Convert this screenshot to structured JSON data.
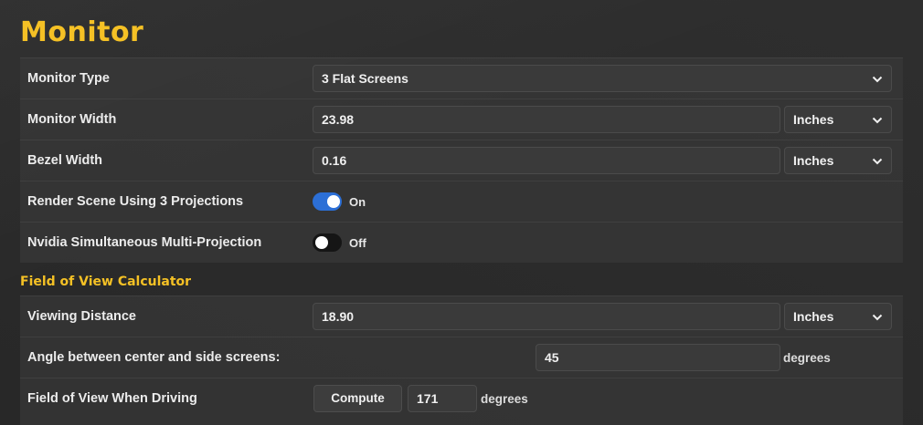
{
  "page": {
    "title": "Monitor"
  },
  "rows": {
    "monitor_type": {
      "label": "Monitor Type",
      "value": "3 Flat Screens"
    },
    "monitor_width": {
      "label": "Monitor Width",
      "value": "23.98",
      "unit": "Inches"
    },
    "bezel_width": {
      "label": "Bezel Width",
      "value": "0.16",
      "unit": "Inches"
    },
    "render_projections": {
      "label": "Render Scene Using 3 Projections",
      "state": "On"
    },
    "nvidia_smp": {
      "label": "Nvidia Simultaneous Multi-Projection",
      "state": "Off"
    }
  },
  "fov": {
    "heading": "Field of View Calculator",
    "viewing_distance": {
      "label": "Viewing Distance",
      "value": "18.90",
      "unit": "Inches"
    },
    "angle": {
      "label": "Angle between center and side screens:",
      "value": "45",
      "unit": "degrees"
    },
    "fov_driving": {
      "label": "Field of View When Driving",
      "button": "Compute",
      "value": "171",
      "unit": "degrees"
    }
  },
  "colors": {
    "accent": "#f5c125",
    "toggle_on": "#2c6fd6",
    "toggle_off": "#151515"
  },
  "icons": {
    "select_caret": "chevron-down-icon"
  }
}
